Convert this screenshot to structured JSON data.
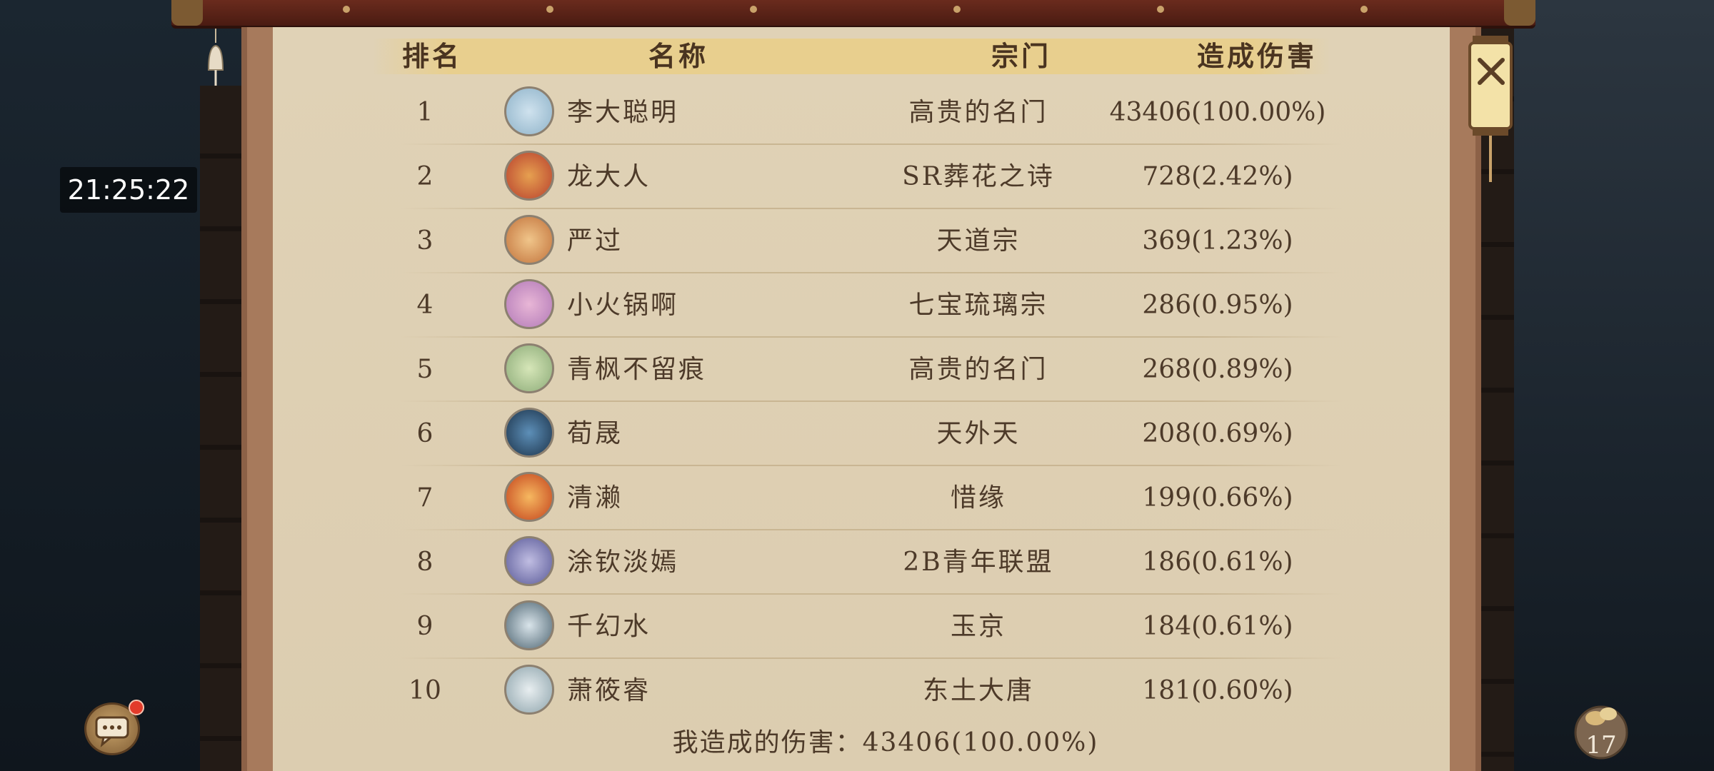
{
  "clock": "21:25:22",
  "headers": {
    "rank": "排名",
    "name": "名称",
    "sect": "宗门",
    "damage": "造成伤害"
  },
  "rows": [
    {
      "rank": "1",
      "name": "李大聪明",
      "sect": "高贵的名门",
      "damage": "43406(100.00%)",
      "avatar_color": "#8fb3c9"
    },
    {
      "rank": "2",
      "name": "龙大人",
      "sect": "SR葬花之诗",
      "damage": "728(2.42%)",
      "avatar_color": "#b8402e"
    },
    {
      "rank": "3",
      "name": "严过",
      "sect": "天道宗",
      "damage": "369(1.23%)",
      "avatar_color": "#c2733c"
    },
    {
      "rank": "4",
      "name": "小火锅啊",
      "sect": "七宝琉璃宗",
      "damage": "286(0.95%)",
      "avatar_color": "#b27ab8"
    },
    {
      "rank": "5",
      "name": "青枫不留痕",
      "sect": "高贵的名门",
      "damage": "268(0.89%)",
      "avatar_color": "#8cab78"
    },
    {
      "rank": "6",
      "name": "荀晟",
      "sect": "天外天",
      "damage": "208(0.69%)",
      "avatar_color": "#2b4e6e"
    },
    {
      "rank": "7",
      "name": "清濑",
      "sect": "惜缘",
      "damage": "199(0.66%)",
      "avatar_color": "#d8652b"
    },
    {
      "rank": "8",
      "name": "涂钦淡嫣",
      "sect": "2B青年联盟",
      "damage": "186(0.61%)",
      "avatar_color": "#6a6aa8"
    },
    {
      "rank": "9",
      "name": "千幻水",
      "sect": "玉京",
      "damage": "184(0.61%)",
      "avatar_color": "#5a7280"
    },
    {
      "rank": "10",
      "name": "萧筱睿",
      "sect": "东土大唐",
      "damage": "181(0.60%)",
      "avatar_color": "#9bb0b8"
    }
  ],
  "footer": "我造成的伤害：43406(100.00%)",
  "bag_count": "17",
  "icons": {
    "close": "close-icon",
    "chat": "chat-icon",
    "bag": "bag-icon",
    "bell": "bell-icon",
    "lantern": "lantern-icon"
  }
}
